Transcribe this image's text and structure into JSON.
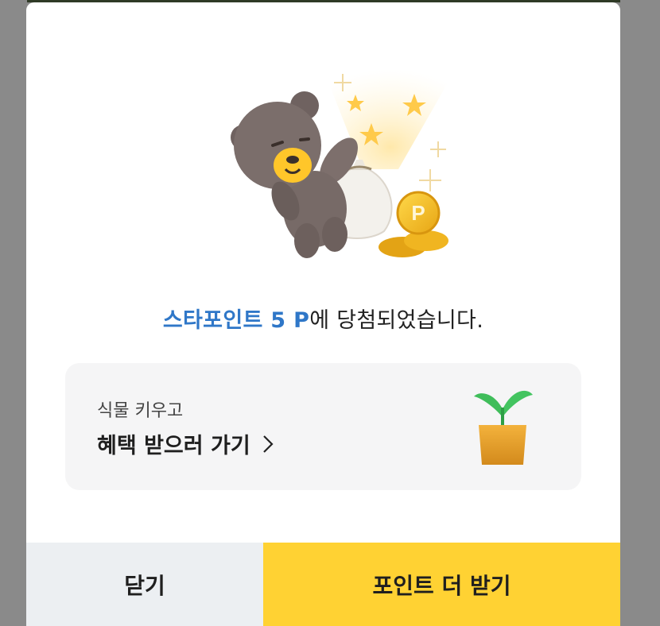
{
  "result": {
    "highlight": "스타포인트 5 P",
    "suffix": "에 당첨되었습니다."
  },
  "promo": {
    "subtitle": "식물 키우고",
    "title": "혜택 받으러 가기"
  },
  "buttons": {
    "close_label": "닫기",
    "more_label": "포인트 더 받기"
  },
  "icons": {
    "coin_letter": "P"
  },
  "colors": {
    "highlight": "#2f77c8",
    "primary_button": "#ffd233",
    "secondary_button": "#eceff2",
    "card_bg": "#f5f5f6"
  }
}
